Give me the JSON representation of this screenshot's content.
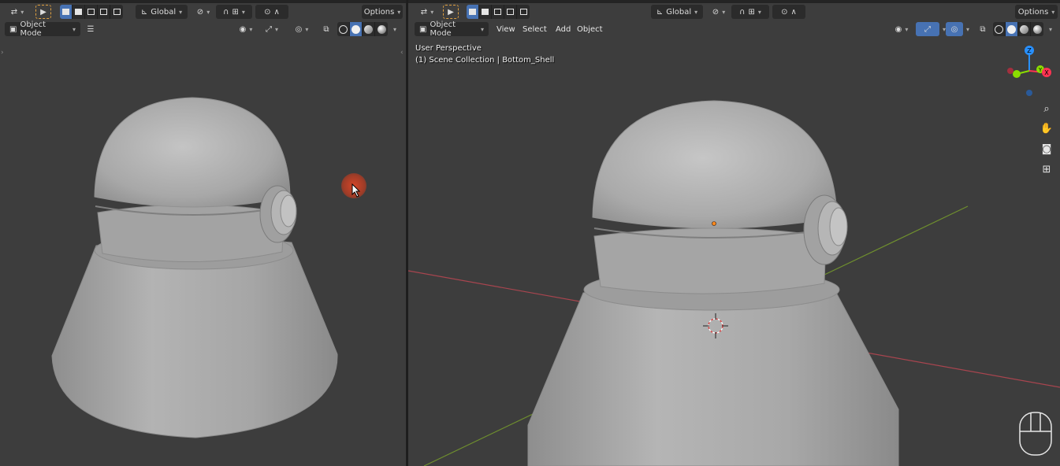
{
  "left_viewport": {
    "header": {
      "orientation_label": "Global",
      "options_label": "Options",
      "mode_label": "Object Mode"
    }
  },
  "right_viewport": {
    "header": {
      "orientation_label": "Global",
      "options_label": "Options",
      "mode_label": "Object Mode",
      "menus": [
        "View",
        "Select",
        "Add",
        "Object"
      ]
    },
    "overlay": {
      "view_name": "User Perspective",
      "collection_info": "(1) Scene Collection | Bottom_Shell"
    },
    "gizmo": {
      "z_label": "Z",
      "y_label": "Y",
      "x_label": "X"
    }
  },
  "colors": {
    "viewport_bg": "#3d3d3d",
    "header_bg": "#2b2b2b",
    "accent_active": "#4772b3",
    "axis_x": "#ff3352",
    "axis_y": "#8bdc00",
    "axis_z": "#2890ff",
    "x_axis_line": "#a8454f",
    "y_axis_line": "#6f8f2e"
  },
  "icons": [
    "transform-pivot-icon",
    "select-box-icon",
    "snap-icon",
    "proportional-edit-icon",
    "visibility-icon",
    "gizmo-icon",
    "overlay-icon",
    "xray-icon",
    "wireframe-shading-icon",
    "solid-shading-icon",
    "material-shading-icon",
    "rendered-shading-icon",
    "zoom-icon",
    "hand-pan-icon",
    "camera-icon",
    "grid-icon",
    "mouse-icon",
    "hamburger-menu-icon"
  ]
}
